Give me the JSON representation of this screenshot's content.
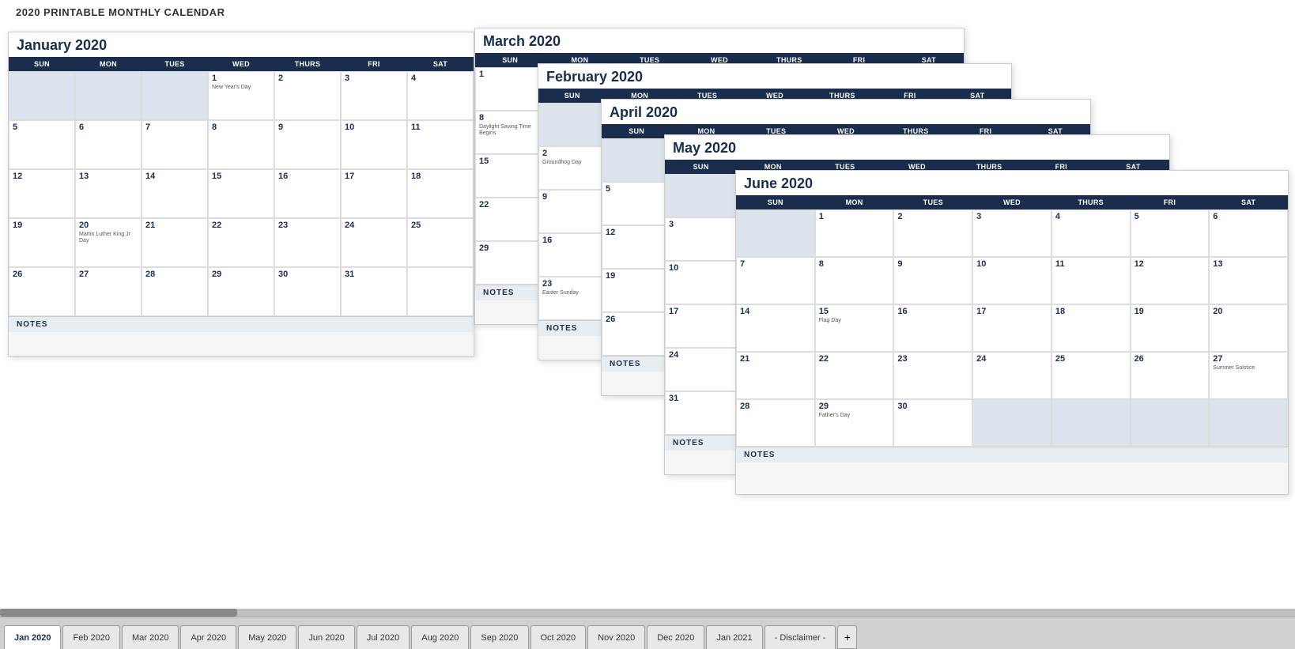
{
  "page": {
    "title": "2020 PRINTABLE MONTHLY CALENDAR"
  },
  "calendars": {
    "january": {
      "title": "January 2020",
      "headers": [
        "SUN",
        "MON",
        "TUES",
        "WED",
        "THURS",
        "FRI",
        "SAT"
      ],
      "notes_label": "NOTES"
    },
    "february": {
      "title": "February 2020",
      "headers": [
        "SUN",
        "MON",
        "TUES",
        "WED",
        "THURS",
        "FRI",
        "SAT"
      ],
      "notes_label": "NOTES"
    },
    "march": {
      "title": "March 2020",
      "headers": [
        "SUN",
        "MON",
        "TUES",
        "WED",
        "THURS",
        "FRI",
        "SAT"
      ],
      "notes_label": "NOTES"
    },
    "april": {
      "title": "April 2020",
      "headers": [
        "SUN",
        "MON",
        "TUES",
        "WED",
        "THURS",
        "FRI",
        "SAT"
      ],
      "notes_label": "NOTES"
    },
    "may": {
      "title": "May 2020",
      "headers": [
        "SUN",
        "MON",
        "TUES",
        "WED",
        "THURS",
        "FRI",
        "SAT"
      ],
      "notes_label": "NOTES"
    },
    "june": {
      "title": "June 2020",
      "headers": [
        "SUN",
        "MON",
        "TUES",
        "WED",
        "THURS",
        "FRI",
        "SAT"
      ],
      "notes_label": "NOTES"
    }
  },
  "tabs": [
    {
      "label": "Jan 2020",
      "active": true
    },
    {
      "label": "Feb 2020",
      "active": false
    },
    {
      "label": "Mar 2020",
      "active": false
    },
    {
      "label": "Apr 2020",
      "active": false
    },
    {
      "label": "May 2020",
      "active": false
    },
    {
      "label": "Jun 2020",
      "active": false
    },
    {
      "label": "Jul 2020",
      "active": false
    },
    {
      "label": "Aug 2020",
      "active": false
    },
    {
      "label": "Sep 2020",
      "active": false
    },
    {
      "label": "Oct 2020",
      "active": false
    },
    {
      "label": "Nov 2020",
      "active": false
    },
    {
      "label": "Dec 2020",
      "active": false
    },
    {
      "label": "Jan 2021",
      "active": false
    },
    {
      "label": "- Disclaimer -",
      "active": false
    }
  ]
}
